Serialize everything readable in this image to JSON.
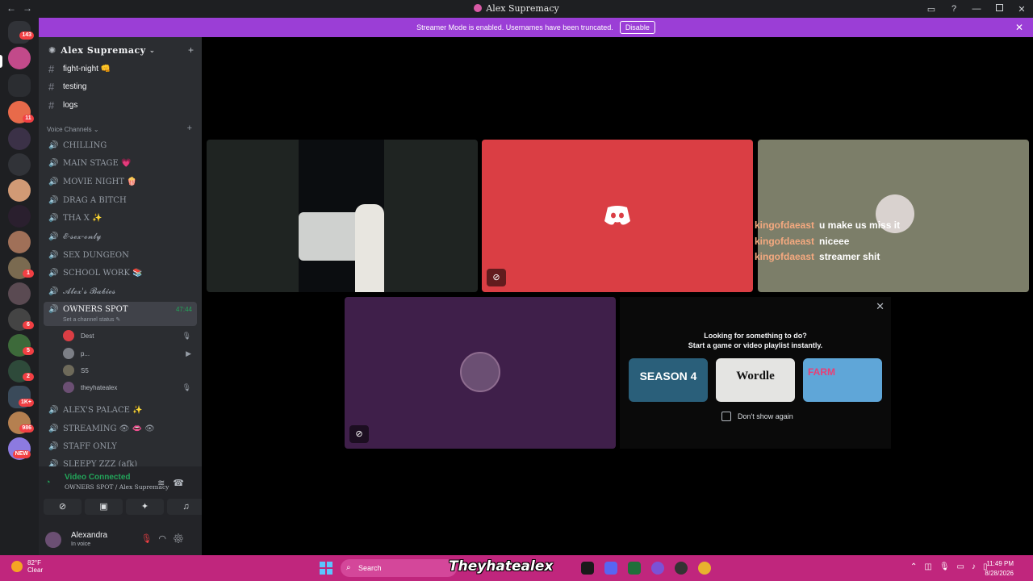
{
  "window": {
    "title": "Alex Supremacy"
  },
  "banner": {
    "text": "Streamer Mode is enabled. Usernames have been truncated.",
    "disable_label": "Disable"
  },
  "rail": {
    "home_badge": "143",
    "badges": [
      "11",
      "1",
      "6",
      "5",
      "2",
      "1K+",
      "986",
      "NEW"
    ]
  },
  "guild": {
    "name": "Alex Supremacy"
  },
  "text_channels": [
    {
      "name": "fight-night 👊"
    },
    {
      "name": "testing"
    },
    {
      "name": "logs"
    }
  ],
  "voice_category": "Voice Channels",
  "voice_channels": [
    {
      "name": "CHILLING"
    },
    {
      "name": "MAIN STAGE 💗"
    },
    {
      "name": "MOVIE NIGHT 🍿"
    },
    {
      "name": "DRAG A BITCH"
    },
    {
      "name": "THA X ✨"
    },
    {
      "name": "𝓔-𝓼𝓮𝔁-𝓸𝓷𝓵𝔂"
    },
    {
      "name": "SEX DUNGEON"
    },
    {
      "name": "SCHOOL WORK 📚"
    },
    {
      "name": "𝓐𝓵𝓮𝔁'𝓼 𝓑𝓪𝓫𝓲𝓮𝓼"
    }
  ],
  "owners_spot": {
    "name": "OWNERS SPOT",
    "timer": "47:44",
    "status_hint": "Set a channel status"
  },
  "members": [
    {
      "name": "Dest"
    },
    {
      "name": "p..."
    },
    {
      "name": "S5"
    },
    {
      "name": "theyhatealex"
    }
  ],
  "voice_channels_after": [
    {
      "name": "ALEX'S PALACE ✨"
    },
    {
      "name": "STREAMING 👁 👄 👁"
    },
    {
      "name": "STAFF ONLY"
    },
    {
      "name": "SLEEPY ZZZ (afk)"
    }
  ],
  "voice_status": {
    "title": "Video Connected",
    "subtitle": "OWNERS SPOT / Alex Supremacy"
  },
  "user": {
    "name": "Alexandra",
    "status": "In voice"
  },
  "overlay_chat": [
    {
      "user": "kingofdaeast",
      "message": "u make us miss it"
    },
    {
      "user": "kingofdaeast",
      "message": "niceee"
    },
    {
      "user": "kingofdaeast",
      "message": "streamer shit"
    }
  ],
  "activity": {
    "line1": "Looking for something to do?",
    "line2": "Start a game or video playlist instantly.",
    "games": [
      "SEASON 4",
      "Wordle",
      "FARM"
    ],
    "dont_show": "Don't show again"
  },
  "taskbar": {
    "temp": "82°F",
    "condition": "Clear",
    "search_label": "Search",
    "brand": "Theyhatealex",
    "time": "11:49 PM",
    "date": "8/28/2026"
  },
  "colors": {
    "accent": "#9b3ed6",
    "discord_red": "#da3e44",
    "green": "#23a55a",
    "taskbar": "#c0267d"
  }
}
